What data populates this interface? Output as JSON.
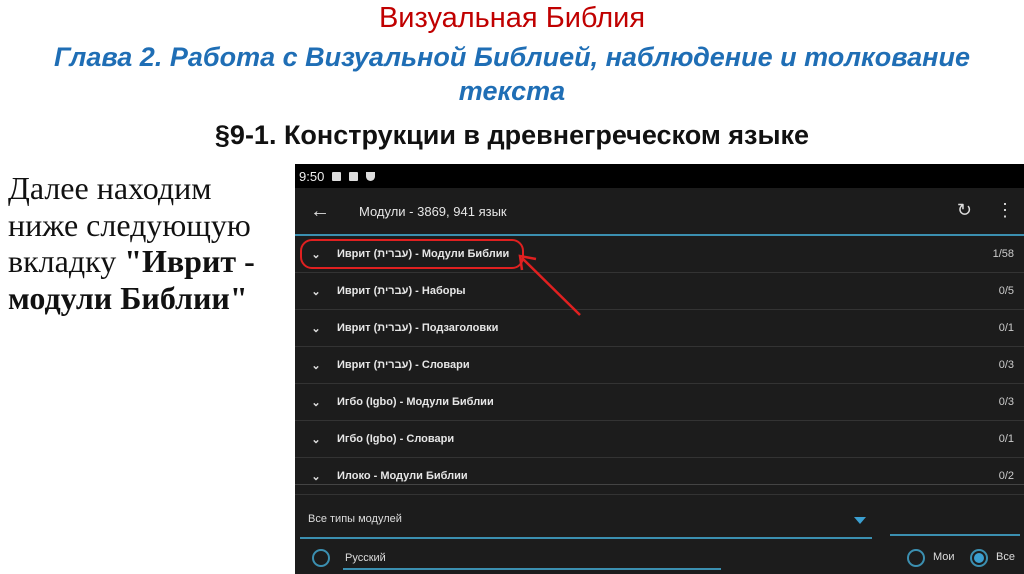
{
  "slide": {
    "title": "Визуальная Библия",
    "subtitle": "Глава 2. Работа с Визуальной Библией, наблюдение и толкование текста",
    "section": "§9-1. Конструкции в древнегреческом языке",
    "body_text": "Далее находим ниже следующую вкладку",
    "body_bold": "\"Иврит - модули Библии\""
  },
  "phone": {
    "time": "9:50",
    "title": "Модули - 3869, 941 язык",
    "rows": [
      {
        "label": "Иврит (עברית) - Модули Библии",
        "count": "1/58"
      },
      {
        "label": "Иврит (עברית) - Наборы",
        "count": "0/5"
      },
      {
        "label": "Иврит (עברית) - Подзаголовки",
        "count": "0/1"
      },
      {
        "label": "Иврит (עברית) - Словари",
        "count": "0/3"
      },
      {
        "label": "Игбо (Igbo) - Модули Библии",
        "count": "0/3"
      },
      {
        "label": "Игбо (Igbo) - Словари",
        "count": "0/1"
      },
      {
        "label": "Илоко - Модули Библии",
        "count": "0/2"
      }
    ],
    "module_type": "Все типы модулей",
    "language_value": "Русский",
    "radio_mine": "Мои",
    "radio_all": "Все",
    "selected_radio": "Все"
  }
}
